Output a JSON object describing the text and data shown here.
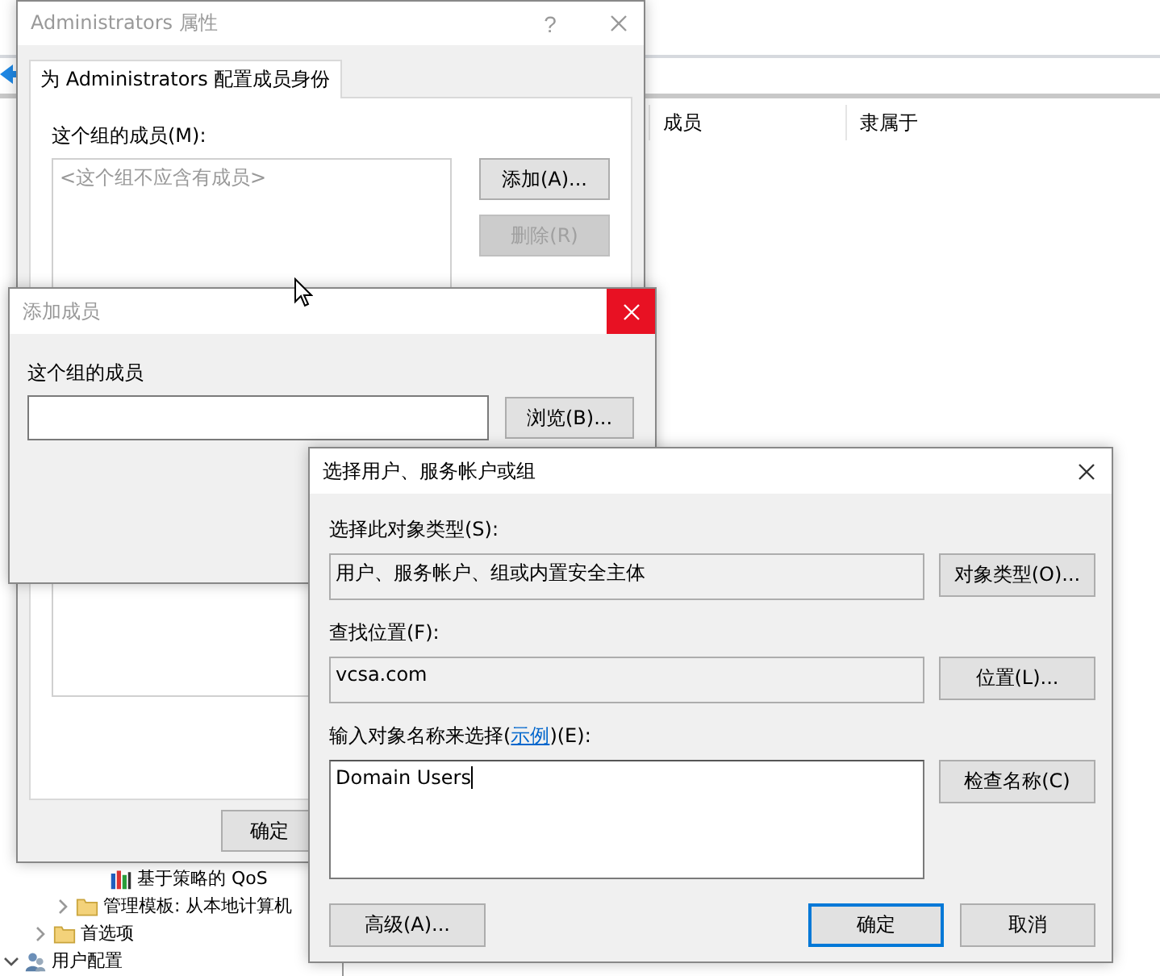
{
  "console": {
    "list_columns": [
      "成员",
      "隶属于"
    ],
    "tree_items": [
      {
        "label": "基于策略的 QoS",
        "kind": "policy"
      },
      {
        "label": "管理模板: 从本地计算机",
        "kind": "folder",
        "expanded": false
      },
      {
        "label": "首选项",
        "kind": "folder",
        "expanded": false
      },
      {
        "label": "用户配置",
        "kind": "user",
        "expanded": true
      }
    ]
  },
  "properties_window": {
    "title": "Administrators 属性",
    "help": "?",
    "active": false,
    "tabs": [
      {
        "label": "为 Administrators 配置成员身份",
        "selected": true
      }
    ],
    "members_label": "这个组的成员(M):",
    "members_placeholder": "<这个组不应含有成员>",
    "buttons": [
      {
        "label": "添加(A)...",
        "disabled": false
      },
      {
        "label": "删除(R)",
        "disabled": true
      }
    ],
    "ok_button": "确定"
  },
  "add_member_dialog": {
    "title": "添加成员",
    "active": false,
    "close_hovered": true,
    "members_label": "这个组的成员",
    "browse_button": "浏览(B)..."
  },
  "select_dialog": {
    "title": "选择用户、服务帐户或组",
    "active": true,
    "close_hovered": false,
    "object_type_label": "选择此对象类型(S):",
    "object_type_value": "用户、服务帐户、组或内置安全主体",
    "object_type_button": "对象类型(O)...",
    "location_label": "查找位置(F):",
    "location_value": "vcsa.com",
    "location_button": "位置(L)...",
    "names_label": {
      "before": "输入对象名称来选择(",
      "link": "示例",
      "after": ")(E):"
    },
    "names_value": "Domain Users",
    "check_button": "检查名称(C)",
    "buttons": [
      {
        "label": "高级(A)...",
        "default": false
      },
      {
        "label": "确定",
        "default": true
      },
      {
        "label": "取消",
        "default": false
      }
    ]
  }
}
